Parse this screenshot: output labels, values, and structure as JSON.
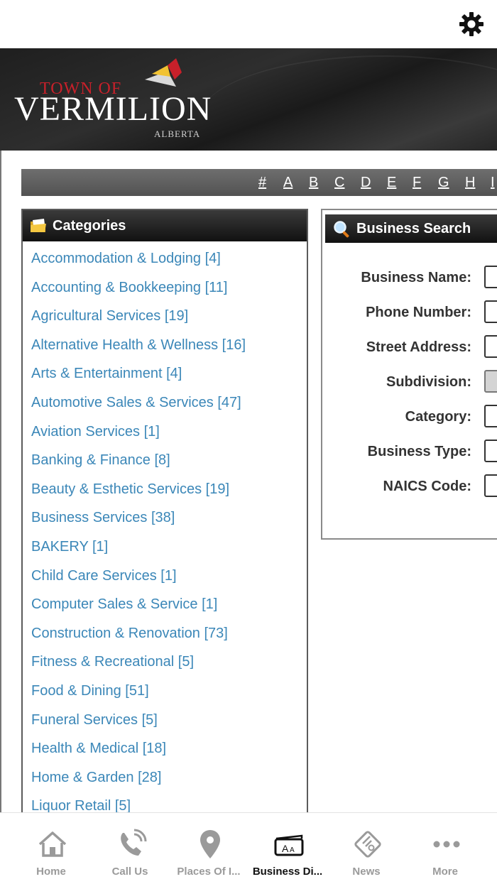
{
  "brand": {
    "town_of": "TOWN OF",
    "name": "VERMILION",
    "province": "ALBERTA"
  },
  "alphabet": [
    "#",
    "A",
    "B",
    "C",
    "D",
    "E",
    "F",
    "G",
    "H",
    "I"
  ],
  "categories": {
    "title": "Categories",
    "items": [
      "Accommodation & Lodging [4]",
      "Accounting & Bookkeeping [11]",
      "Agricultural Services [19]",
      "Alternative Health & Wellness [16]",
      "Arts & Entertainment [4]",
      "Automotive Sales & Services [47]",
      "Aviation Services [1]",
      "Banking & Finance [8]",
      "Beauty & Esthetic Services [19]",
      "Business Services [38]",
      "BAKERY [1]",
      "Child Care Services [1]",
      "Computer Sales & Service [1]",
      "Construction & Renovation [73]",
      "Fitness & Recreational [5]",
      "Food & Dining [51]",
      "Funeral Services [5]",
      "Health & Medical [18]",
      "Home & Garden [28]",
      "Liquor Retail [5]"
    ]
  },
  "search": {
    "title": "Business Search",
    "fields": [
      "Business Name:",
      "Phone Number:",
      "Street Address:",
      "Subdivision:",
      "Category:",
      "Business Type:",
      "NAICS Code:"
    ]
  },
  "tabs": [
    {
      "label": "Home",
      "icon": "home-icon"
    },
    {
      "label": "Call Us",
      "icon": "phone-icon"
    },
    {
      "label": "Places Of I...",
      "icon": "map-pin-icon"
    },
    {
      "label": "Business Di...",
      "icon": "business-directory-icon"
    },
    {
      "label": "News",
      "icon": "news-icon"
    },
    {
      "label": "More",
      "icon": "more-icon"
    }
  ],
  "colors": {
    "link": "#3b87b8",
    "brand_red": "#c8202a",
    "active_tab": "#111111",
    "inactive_tab": "#9a9a9a"
  }
}
